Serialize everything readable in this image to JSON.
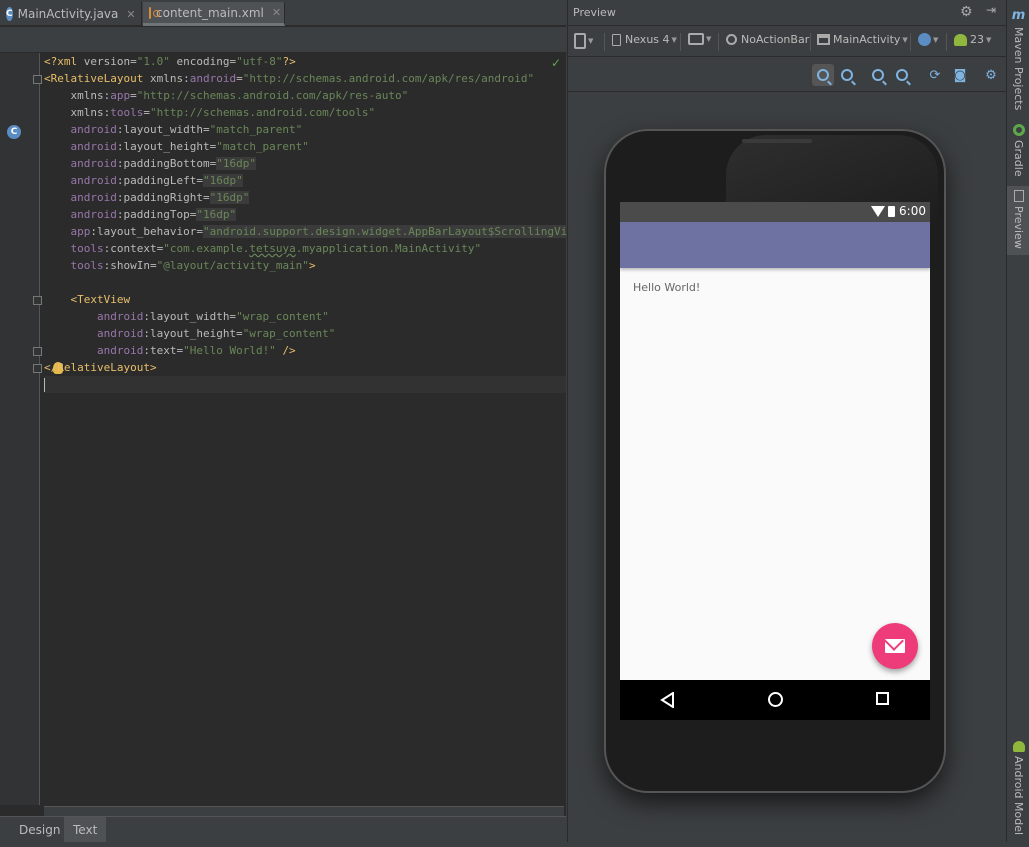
{
  "editor": {
    "tabs": [
      {
        "label": "MainActivity.java",
        "close": "✕"
      },
      {
        "label": "content_main.xml",
        "close": "✕"
      }
    ],
    "gutter_icon": "C",
    "lines": [
      "<?xml version=\"1.0\" encoding=\"utf-8\"?>",
      "<RelativeLayout xmlns:android=\"http://schemas.android.com/apk/res/android\"",
      "    xmlns:app=\"http://schemas.android.com/apk/res-auto\"",
      "    xmlns:tools=\"http://schemas.android.com/tools\"",
      "    android:layout_width=\"match_parent\"",
      "    android:layout_height=\"match_parent\"",
      "    android:paddingBottom=\"16dp\"",
      "    android:paddingLeft=\"16dp\"",
      "    android:paddingRight=\"16dp\"",
      "    android:paddingTop=\"16dp\"",
      "    app:layout_behavior=\"android.support.design.widget.AppBarLayout$ScrollingVie...\"",
      "    tools:context=\"com.example.tetsuya.myapplication.MainActivity\"",
      "    tools:showIn=\"@layout/activity_main\">",
      "",
      "    <TextView",
      "        android:layout_width=\"wrap_content\"",
      "        android:layout_height=\"wrap_content\"",
      "        android:text=\"Hello World!\" />",
      "</RelativeLayout>",
      ""
    ],
    "bottom_tabs": [
      "Design",
      "Text"
    ]
  },
  "preview": {
    "title": "Preview",
    "toolbar": {
      "device": "Nexus 4",
      "theme": "NoActionBar",
      "activity": "MainActivity",
      "api": "23"
    },
    "phone": {
      "time": "6:00",
      "hello_text": "Hello World!"
    }
  },
  "sidebar": {
    "tabs": [
      "Maven Projects",
      "Gradle",
      "Preview",
      "Android Model"
    ]
  },
  "colors": {
    "app_bar": "#6d72a3",
    "fab": "#ee3c7a",
    "tag": "#e8bf6a",
    "value": "#6a8759",
    "namespace": "#9876aa"
  }
}
